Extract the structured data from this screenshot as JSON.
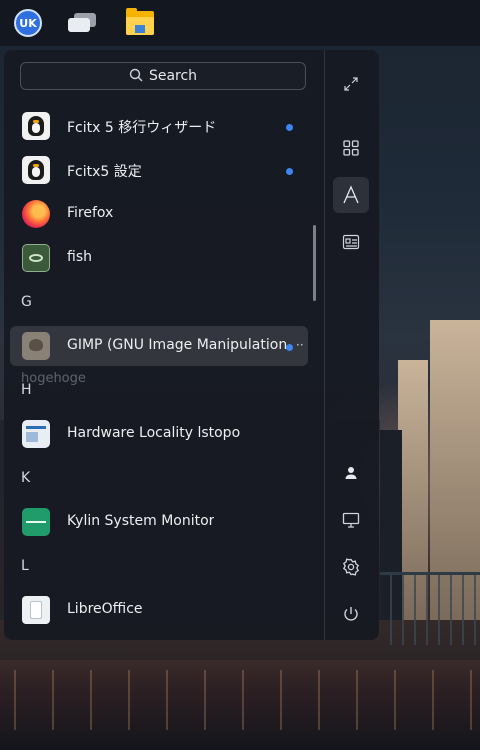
{
  "taskbar": {
    "start_logo_text": "UK",
    "icons": [
      "ukui-start-icon",
      "multitask-view-icon",
      "file-manager-icon"
    ]
  },
  "desktop": {
    "ghost_labels": [
      "hogehoge"
    ]
  },
  "menu": {
    "search_label": "Search",
    "apps": [
      {
        "label": "Fcitx 5 移行ウィザード",
        "icon": "tux-icon",
        "new": true
      },
      {
        "label": "Fcitx5 設定",
        "icon": "tux-icon",
        "new": true
      },
      {
        "label": "Firefox",
        "icon": "firefox-icon",
        "new": false
      },
      {
        "label": "fish",
        "icon": "fish-terminal-icon",
        "new": false
      }
    ],
    "letter_g": "G",
    "gimp": {
      "label": "GIMP (GNU Image Manipulation Program)",
      "more": "··",
      "new": true
    },
    "letter_h": "H",
    "hwloc": {
      "label": "Hardware Locality lstopo"
    },
    "letter_k": "K",
    "kylin": {
      "label": "Kylin System Monitor"
    },
    "letter_l": "L",
    "libre": {
      "label": "LibreOffice"
    }
  },
  "sidebar": {
    "top": [
      "expand-icon",
      "all-apps-icon",
      "letter-sort-icon",
      "category-icon"
    ],
    "bottom": [
      "user-icon",
      "computer-icon",
      "settings-icon",
      "power-icon"
    ],
    "active": "letter-sort-icon"
  },
  "colors": {
    "accent": "#3d86f0",
    "menu_bg": "#161a22",
    "taskbar_bg": "#131820"
  }
}
